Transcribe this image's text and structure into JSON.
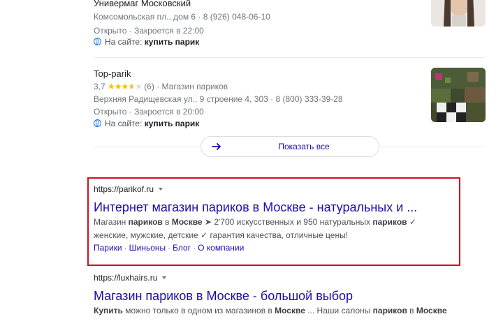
{
  "local_results": [
    {
      "name": "Универмаг Московский",
      "address": "Комсомольская пл., дом 6 · 8 (926) 048-06-10",
      "status": "Открыто · Закроется в 22:00",
      "site_prefix": "На сайте:",
      "site_term": "купить парик"
    },
    {
      "name": "Top-parik",
      "rating_value": "3,7",
      "rating": 3.7,
      "reviews": "(6)",
      "category": "· Магазин париков",
      "address": "Верхняя Радищевская ул., 9 строение 4, 303 · 8 (800) 333-39-28",
      "status": "Открыто · Закроется в 20:00",
      "site_prefix": "На сайте:",
      "site_term": "купить парик"
    }
  ],
  "show_all_label": "Показать все",
  "results": [
    {
      "url": "https://parikof.ru",
      "title": "Интернет магазин париков в Москве - натуральных и ...",
      "snippet_line1": [
        "Магазин ",
        "париков",
        " в ",
        "Москве",
        " ➤ 2'700 искусственных и 950 натуральных ",
        "париков",
        " ✓"
      ],
      "snippet_line2": "женские, мужские, детские ✓ гарантия качества, отличные цены!",
      "sitelinks": [
        "Парики",
        "Шиньоны",
        "Блог",
        "О компании"
      ]
    },
    {
      "url": "https://luxhairs.ru",
      "title": "Магазин париков в Москве - большой выбор",
      "snippet_line1": [
        "Купить",
        " можно только в одном из магазинов в ",
        "Москве",
        " ... Наши салоны ",
        "париков",
        " в ",
        "Москве"
      ]
    }
  ],
  "colors": {
    "link": "#1a0dab",
    "highlight_border": "#d0101f",
    "star": "#fbbc04"
  },
  "icons": [
    "globe-icon",
    "arrow-right-icon",
    "dropdown-caret-icon"
  ]
}
